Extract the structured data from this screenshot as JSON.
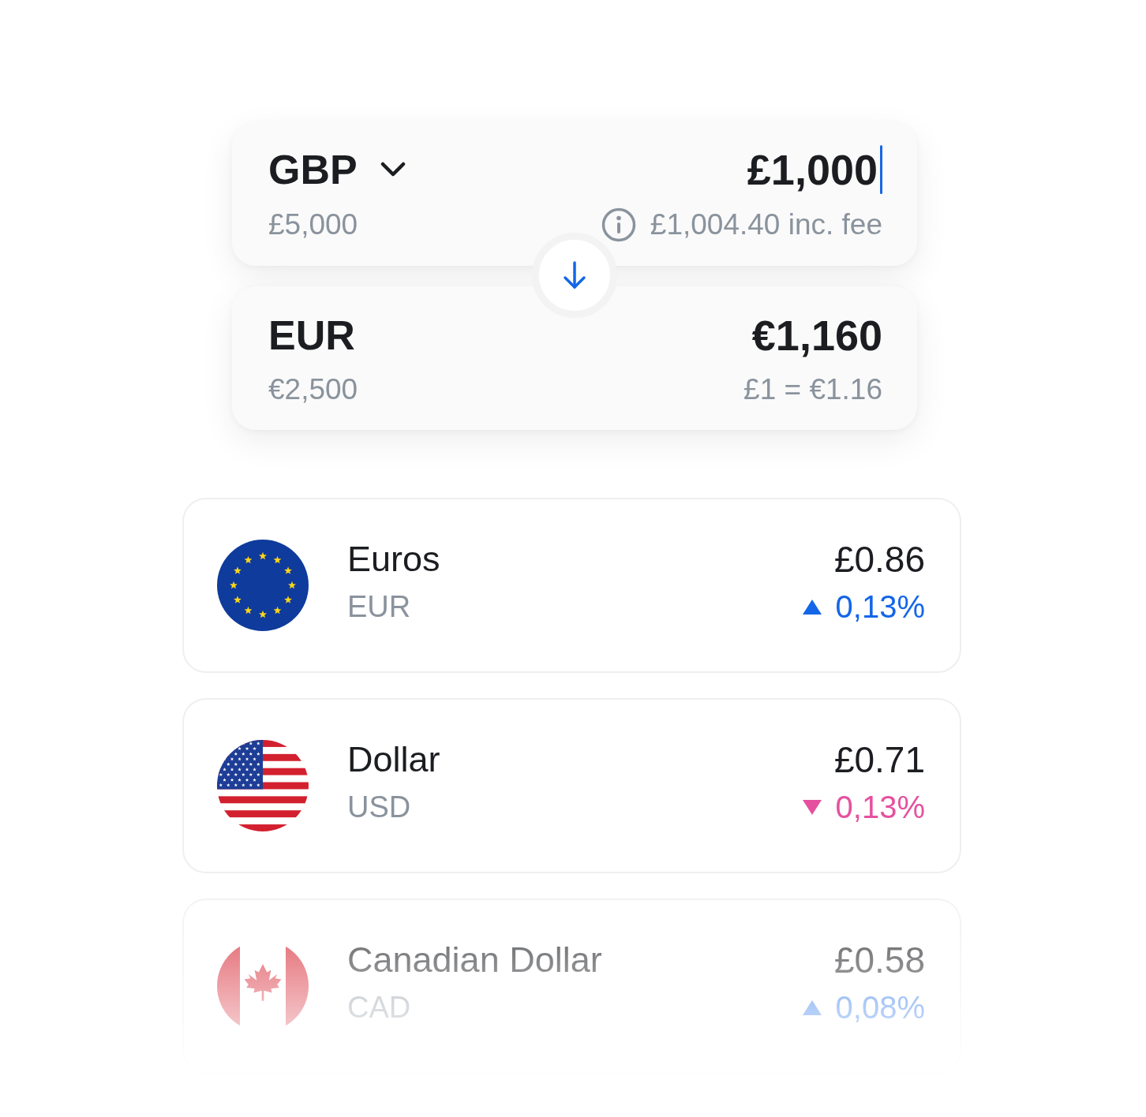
{
  "converter": {
    "from": {
      "currency": "GBP",
      "amount": "£1,000",
      "balance": "£5,000",
      "fee_note": "£1,004.40 inc. fee"
    },
    "to": {
      "currency": "EUR",
      "amount": "€1,160",
      "balance": "€2,500",
      "rate": "£1 = €1.16"
    }
  },
  "rates": [
    {
      "kind": "eu",
      "name": "Euros",
      "code": "EUR",
      "price": "£0.86",
      "rising": true,
      "change": "0,13%",
      "faded": false
    },
    {
      "kind": "us",
      "name": "Dollar",
      "code": "USD",
      "price": "£0.71",
      "rising": false,
      "change": "0,13%",
      "faded": false
    },
    {
      "kind": "ca",
      "name": "Canadian Dollar",
      "code": "CAD",
      "price": "£0.58",
      "rising": true,
      "change": "0,08%",
      "faded": true
    }
  ]
}
